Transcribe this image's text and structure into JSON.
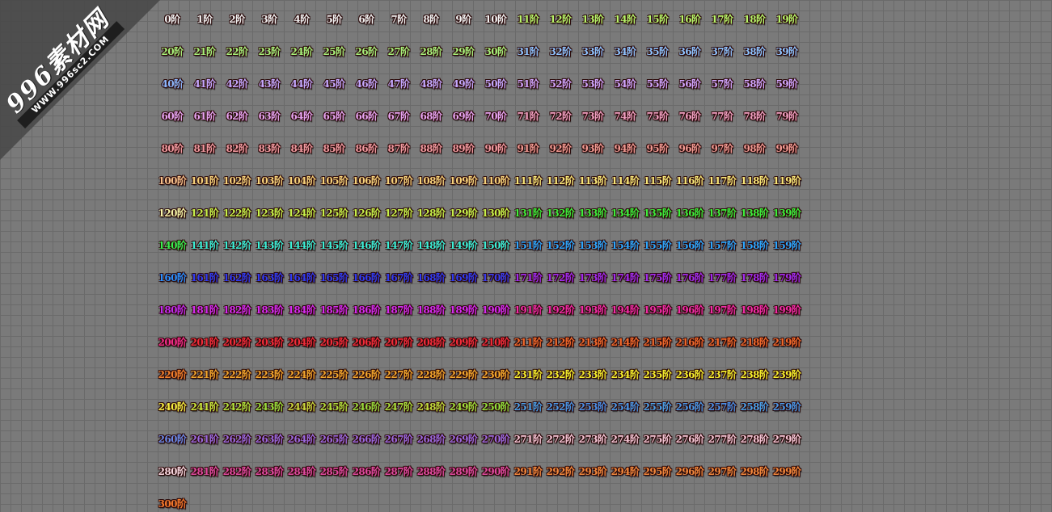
{
  "watermark": {
    "main": "996素材网",
    "sub": "WWW.996sc2.COM"
  },
  "level_suffix": "阶",
  "levels": [
    {
      "n": 0,
      "color": "#f4f4f4"
    },
    {
      "n": 1,
      "color": "#f2f2f2"
    },
    {
      "n": 2,
      "color": "#f2f2f2"
    },
    {
      "n": 3,
      "color": "#f2f2f2"
    },
    {
      "n": 4,
      "color": "#f2f2f2"
    },
    {
      "n": 5,
      "color": "#f2f2f2"
    },
    {
      "n": 6,
      "color": "#f2f2f2"
    },
    {
      "n": 7,
      "color": "#f2f2f2"
    },
    {
      "n": 8,
      "color": "#f2f2f2"
    },
    {
      "n": 9,
      "color": "#f2f2f2"
    },
    {
      "n": 10,
      "color": "#f2f2f2"
    },
    {
      "n": 11,
      "color": "#b6f56a"
    },
    {
      "n": 12,
      "color": "#b6f56a"
    },
    {
      "n": 13,
      "color": "#b6f56a"
    },
    {
      "n": 14,
      "color": "#b6f56a"
    },
    {
      "n": 15,
      "color": "#b6f56a"
    },
    {
      "n": 16,
      "color": "#b6f56a"
    },
    {
      "n": 17,
      "color": "#b6f56a"
    },
    {
      "n": 18,
      "color": "#b6f56a"
    },
    {
      "n": 19,
      "color": "#b6f56a"
    },
    {
      "n": 20,
      "color": "#a6f07a"
    },
    {
      "n": 21,
      "color": "#a6f07a"
    },
    {
      "n": 22,
      "color": "#a6f07a"
    },
    {
      "n": 23,
      "color": "#a6f07a"
    },
    {
      "n": 24,
      "color": "#a6f07a"
    },
    {
      "n": 25,
      "color": "#a6f07a"
    },
    {
      "n": 26,
      "color": "#a6f07a"
    },
    {
      "n": 27,
      "color": "#a6f07a"
    },
    {
      "n": 28,
      "color": "#a6f07a"
    },
    {
      "n": 29,
      "color": "#a6f07a"
    },
    {
      "n": 30,
      "color": "#a6f07a"
    },
    {
      "n": 31,
      "color": "#8ec4ff"
    },
    {
      "n": 32,
      "color": "#8ec4ff"
    },
    {
      "n": 33,
      "color": "#8ec4ff"
    },
    {
      "n": 34,
      "color": "#8ec4ff"
    },
    {
      "n": 35,
      "color": "#8ec4ff"
    },
    {
      "n": 36,
      "color": "#8ec4ff"
    },
    {
      "n": 37,
      "color": "#8ec4ff"
    },
    {
      "n": 38,
      "color": "#8ec4ff"
    },
    {
      "n": 39,
      "color": "#8ec4ff"
    },
    {
      "n": 40,
      "color": "#8cb8ff"
    },
    {
      "n": 41,
      "color": "#c4a8ff"
    },
    {
      "n": 42,
      "color": "#c4a8ff"
    },
    {
      "n": 43,
      "color": "#c4a8ff"
    },
    {
      "n": 44,
      "color": "#c4a8ff"
    },
    {
      "n": 45,
      "color": "#c4a8ff"
    },
    {
      "n": 46,
      "color": "#c4a8ff"
    },
    {
      "n": 47,
      "color": "#c4a8ff"
    },
    {
      "n": 48,
      "color": "#c4a8ff"
    },
    {
      "n": 49,
      "color": "#c4a8ff"
    },
    {
      "n": 50,
      "color": "#c4a8ff"
    },
    {
      "n": 51,
      "color": "#d0a6ff"
    },
    {
      "n": 52,
      "color": "#d0a6ff"
    },
    {
      "n": 53,
      "color": "#d0a6ff"
    },
    {
      "n": 54,
      "color": "#d0a6ff"
    },
    {
      "n": 55,
      "color": "#d0a6ff"
    },
    {
      "n": 56,
      "color": "#d0a6ff"
    },
    {
      "n": 57,
      "color": "#d0a6ff"
    },
    {
      "n": 58,
      "color": "#d0a6ff"
    },
    {
      "n": 59,
      "color": "#d0a6ff"
    },
    {
      "n": 60,
      "color": "#e6a4f2"
    },
    {
      "n": 61,
      "color": "#e6a4f2"
    },
    {
      "n": 62,
      "color": "#e6a4f2"
    },
    {
      "n": 63,
      "color": "#e6a4f2"
    },
    {
      "n": 64,
      "color": "#e6a4f2"
    },
    {
      "n": 65,
      "color": "#e6a4f2"
    },
    {
      "n": 66,
      "color": "#e6a4f2"
    },
    {
      "n": 67,
      "color": "#e6a4f2"
    },
    {
      "n": 68,
      "color": "#e6a4f2"
    },
    {
      "n": 69,
      "color": "#e6a4f2"
    },
    {
      "n": 70,
      "color": "#e6a4f2"
    },
    {
      "n": 71,
      "color": "#f2a0c2"
    },
    {
      "n": 72,
      "color": "#f2a0c2"
    },
    {
      "n": 73,
      "color": "#f2a0c2"
    },
    {
      "n": 74,
      "color": "#f2a0c2"
    },
    {
      "n": 75,
      "color": "#f2a0c2"
    },
    {
      "n": 76,
      "color": "#f2a0c2"
    },
    {
      "n": 77,
      "color": "#f2a0c2"
    },
    {
      "n": 78,
      "color": "#f2a0c2"
    },
    {
      "n": 79,
      "color": "#f2a0c2"
    },
    {
      "n": 80,
      "color": "#f29aa0"
    },
    {
      "n": 81,
      "color": "#f29aa0"
    },
    {
      "n": 82,
      "color": "#f29aa0"
    },
    {
      "n": 83,
      "color": "#f29aa0"
    },
    {
      "n": 84,
      "color": "#f29aa0"
    },
    {
      "n": 85,
      "color": "#f29aa0"
    },
    {
      "n": 86,
      "color": "#f29aa0"
    },
    {
      "n": 87,
      "color": "#f29aa0"
    },
    {
      "n": 88,
      "color": "#f29aa0"
    },
    {
      "n": 89,
      "color": "#f29aa0"
    },
    {
      "n": 90,
      "color": "#f29aa0"
    },
    {
      "n": 91,
      "color": "#f29a92"
    },
    {
      "n": 92,
      "color": "#f29a92"
    },
    {
      "n": 93,
      "color": "#f29a92"
    },
    {
      "n": 94,
      "color": "#f29a92"
    },
    {
      "n": 95,
      "color": "#f29a92"
    },
    {
      "n": 96,
      "color": "#f29a92"
    },
    {
      "n": 97,
      "color": "#f29a92"
    },
    {
      "n": 98,
      "color": "#f29a92"
    },
    {
      "n": 99,
      "color": "#f29a92"
    },
    {
      "n": 100,
      "color": "#f6c08a"
    },
    {
      "n": 101,
      "color": "#f6d27a"
    },
    {
      "n": 102,
      "color": "#f6d27a"
    },
    {
      "n": 103,
      "color": "#f6d27a"
    },
    {
      "n": 104,
      "color": "#f6d27a"
    },
    {
      "n": 105,
      "color": "#f6d27a"
    },
    {
      "n": 106,
      "color": "#f6d27a"
    },
    {
      "n": 107,
      "color": "#f6d27a"
    },
    {
      "n": 108,
      "color": "#f6d27a"
    },
    {
      "n": 109,
      "color": "#f6d27a"
    },
    {
      "n": 110,
      "color": "#f6d27a"
    },
    {
      "n": 111,
      "color": "#f8e878"
    },
    {
      "n": 112,
      "color": "#f8e878"
    },
    {
      "n": 113,
      "color": "#f8e878"
    },
    {
      "n": 114,
      "color": "#f8e878"
    },
    {
      "n": 115,
      "color": "#f8e878"
    },
    {
      "n": 116,
      "color": "#f8e878"
    },
    {
      "n": 117,
      "color": "#f8e878"
    },
    {
      "n": 118,
      "color": "#f8e878"
    },
    {
      "n": 119,
      "color": "#f8e878"
    },
    {
      "n": 120,
      "color": "#f6f6a8"
    },
    {
      "n": 121,
      "color": "#c6f24a"
    },
    {
      "n": 122,
      "color": "#c6f24a"
    },
    {
      "n": 123,
      "color": "#c6f24a"
    },
    {
      "n": 124,
      "color": "#c6f24a"
    },
    {
      "n": 125,
      "color": "#c6f24a"
    },
    {
      "n": 126,
      "color": "#c6f24a"
    },
    {
      "n": 127,
      "color": "#c6f24a"
    },
    {
      "n": 128,
      "color": "#c6f24a"
    },
    {
      "n": 129,
      "color": "#c6f24a"
    },
    {
      "n": 130,
      "color": "#c6f24a"
    },
    {
      "n": 131,
      "color": "#3cf03c"
    },
    {
      "n": 132,
      "color": "#3cf03c"
    },
    {
      "n": 133,
      "color": "#3cf03c"
    },
    {
      "n": 134,
      "color": "#3cf03c"
    },
    {
      "n": 135,
      "color": "#3cf03c"
    },
    {
      "n": 136,
      "color": "#3cf03c"
    },
    {
      "n": 137,
      "color": "#3cf03c"
    },
    {
      "n": 138,
      "color": "#3cf03c"
    },
    {
      "n": 139,
      "color": "#3cf03c"
    },
    {
      "n": 140,
      "color": "#38f050"
    },
    {
      "n": 141,
      "color": "#3cf0d8"
    },
    {
      "n": 142,
      "color": "#3cf0d8"
    },
    {
      "n": 143,
      "color": "#3cf0d8"
    },
    {
      "n": 144,
      "color": "#3cf0d8"
    },
    {
      "n": 145,
      "color": "#3cf0d8"
    },
    {
      "n": 146,
      "color": "#3cf0d8"
    },
    {
      "n": 147,
      "color": "#3cf0d8"
    },
    {
      "n": 148,
      "color": "#3cf0d8"
    },
    {
      "n": 149,
      "color": "#3cf0d8"
    },
    {
      "n": 150,
      "color": "#3cf0d8"
    },
    {
      "n": 151,
      "color": "#2ca8ff"
    },
    {
      "n": 152,
      "color": "#2ca8ff"
    },
    {
      "n": 153,
      "color": "#2ca8ff"
    },
    {
      "n": 154,
      "color": "#2ca8ff"
    },
    {
      "n": 155,
      "color": "#2ca8ff"
    },
    {
      "n": 156,
      "color": "#2ca8ff"
    },
    {
      "n": 157,
      "color": "#2ca8ff"
    },
    {
      "n": 158,
      "color": "#2ca8ff"
    },
    {
      "n": 159,
      "color": "#2ca8ff"
    },
    {
      "n": 160,
      "color": "#2a90ff"
    },
    {
      "n": 161,
      "color": "#2f3cf2"
    },
    {
      "n": 162,
      "color": "#2f3cf2"
    },
    {
      "n": 163,
      "color": "#2f3cf2"
    },
    {
      "n": 164,
      "color": "#2f3cf2"
    },
    {
      "n": 165,
      "color": "#2f3cf2"
    },
    {
      "n": 166,
      "color": "#2f3cf2"
    },
    {
      "n": 167,
      "color": "#2f3cf2"
    },
    {
      "n": 168,
      "color": "#2f3cf2"
    },
    {
      "n": 169,
      "color": "#2f3cf2"
    },
    {
      "n": 170,
      "color": "#3a3ef0"
    },
    {
      "n": 171,
      "color": "#a02cf0"
    },
    {
      "n": 172,
      "color": "#a02cf0"
    },
    {
      "n": 173,
      "color": "#a02cf0"
    },
    {
      "n": 174,
      "color": "#a02cf0"
    },
    {
      "n": 175,
      "color": "#a02cf0"
    },
    {
      "n": 176,
      "color": "#a02cf0"
    },
    {
      "n": 177,
      "color": "#a02cf0"
    },
    {
      "n": 178,
      "color": "#a02cf0"
    },
    {
      "n": 179,
      "color": "#a02cf0"
    },
    {
      "n": 180,
      "color": "#c02cf0"
    },
    {
      "n": 181,
      "color": "#d42cf2"
    },
    {
      "n": 182,
      "color": "#d42cf2"
    },
    {
      "n": 183,
      "color": "#d42cf2"
    },
    {
      "n": 184,
      "color": "#d42cf2"
    },
    {
      "n": 185,
      "color": "#d42cf2"
    },
    {
      "n": 186,
      "color": "#d42cf2"
    },
    {
      "n": 187,
      "color": "#d42cf2"
    },
    {
      "n": 188,
      "color": "#d42cf2"
    },
    {
      "n": 189,
      "color": "#d42cf2"
    },
    {
      "n": 190,
      "color": "#d42cf2"
    },
    {
      "n": 191,
      "color": "#f22ca8"
    },
    {
      "n": 192,
      "color": "#f22ca8"
    },
    {
      "n": 193,
      "color": "#f22ca8"
    },
    {
      "n": 194,
      "color": "#f22ca8"
    },
    {
      "n": 195,
      "color": "#f22ca8"
    },
    {
      "n": 196,
      "color": "#f22ca8"
    },
    {
      "n": 197,
      "color": "#f22ca8"
    },
    {
      "n": 198,
      "color": "#f22ca8"
    },
    {
      "n": 199,
      "color": "#f22ca8"
    },
    {
      "n": 200,
      "color": "#f22c8a"
    },
    {
      "n": 201,
      "color": "#f22c3a"
    },
    {
      "n": 202,
      "color": "#f22c3a"
    },
    {
      "n": 203,
      "color": "#f22c3a"
    },
    {
      "n": 204,
      "color": "#f22c3a"
    },
    {
      "n": 205,
      "color": "#f22c3a"
    },
    {
      "n": 206,
      "color": "#f22c3a"
    },
    {
      "n": 207,
      "color": "#f22c3a"
    },
    {
      "n": 208,
      "color": "#f22c3a"
    },
    {
      "n": 209,
      "color": "#f22c3a"
    },
    {
      "n": 210,
      "color": "#f22c3a"
    },
    {
      "n": 211,
      "color": "#f26a2c"
    },
    {
      "n": 212,
      "color": "#f26a2c"
    },
    {
      "n": 213,
      "color": "#f26a2c"
    },
    {
      "n": 214,
      "color": "#f26a2c"
    },
    {
      "n": 215,
      "color": "#f26a2c"
    },
    {
      "n": 216,
      "color": "#f26a2c"
    },
    {
      "n": 217,
      "color": "#f26a2c"
    },
    {
      "n": 218,
      "color": "#f26a2c"
    },
    {
      "n": 219,
      "color": "#f26a2c"
    },
    {
      "n": 220,
      "color": "#f2802c"
    },
    {
      "n": 221,
      "color": "#f2a62c"
    },
    {
      "n": 222,
      "color": "#f2a62c"
    },
    {
      "n": 223,
      "color": "#f2a62c"
    },
    {
      "n": 224,
      "color": "#f2a62c"
    },
    {
      "n": 225,
      "color": "#f2a62c"
    },
    {
      "n": 226,
      "color": "#f2a62c"
    },
    {
      "n": 227,
      "color": "#f2a62c"
    },
    {
      "n": 228,
      "color": "#f2a62c"
    },
    {
      "n": 229,
      "color": "#f2a62c"
    },
    {
      "n": 230,
      "color": "#f2a62c"
    },
    {
      "n": 231,
      "color": "#f6f02c"
    },
    {
      "n": 232,
      "color": "#f6f02c"
    },
    {
      "n": 233,
      "color": "#f6f02c"
    },
    {
      "n": 234,
      "color": "#f6f02c"
    },
    {
      "n": 235,
      "color": "#f6f02c"
    },
    {
      "n": 236,
      "color": "#f6f02c"
    },
    {
      "n": 237,
      "color": "#f6f02c"
    },
    {
      "n": 238,
      "color": "#f6f02c"
    },
    {
      "n": 239,
      "color": "#f6f02c"
    },
    {
      "n": 240,
      "color": "#f6f040"
    },
    {
      "n": 241,
      "color": "#c8e83c"
    },
    {
      "n": 242,
      "color": "#b0e43c"
    },
    {
      "n": 243,
      "color": "#98e03c"
    },
    {
      "n": 244,
      "color": "#c8d83c"
    },
    {
      "n": 245,
      "color": "#b0e03c"
    },
    {
      "n": 246,
      "color": "#98dc3c"
    },
    {
      "n": 247,
      "color": "#a8e03c"
    },
    {
      "n": 248,
      "color": "#c0dc3c"
    },
    {
      "n": 249,
      "color": "#a0e03c"
    },
    {
      "n": 250,
      "color": "#90e03c"
    },
    {
      "n": 251,
      "color": "#4aa0e8"
    },
    {
      "n": 252,
      "color": "#4a98e8"
    },
    {
      "n": 253,
      "color": "#4a90e8"
    },
    {
      "n": 254,
      "color": "#4a98e8"
    },
    {
      "n": 255,
      "color": "#4aa0e8"
    },
    {
      "n": 256,
      "color": "#4a98e8"
    },
    {
      "n": 257,
      "color": "#4a90e8"
    },
    {
      "n": 258,
      "color": "#4aa0e8"
    },
    {
      "n": 259,
      "color": "#4a98e8"
    },
    {
      "n": 260,
      "color": "#6a8ae8"
    },
    {
      "n": 261,
      "color": "#9a6ae0"
    },
    {
      "n": 262,
      "color": "#9a6ae0"
    },
    {
      "n": 263,
      "color": "#9a6ae0"
    },
    {
      "n": 264,
      "color": "#9a6ae0"
    },
    {
      "n": 265,
      "color": "#9a6ae0"
    },
    {
      "n": 266,
      "color": "#9a6ae0"
    },
    {
      "n": 267,
      "color": "#9a6ae0"
    },
    {
      "n": 268,
      "color": "#9a6ae0"
    },
    {
      "n": 269,
      "color": "#9a6ae0"
    },
    {
      "n": 270,
      "color": "#9a6ae0"
    },
    {
      "n": 271,
      "color": "#f6c6d6"
    },
    {
      "n": 272,
      "color": "#f6c6d6"
    },
    {
      "n": 273,
      "color": "#f6c6d6"
    },
    {
      "n": 274,
      "color": "#f6c6d6"
    },
    {
      "n": 275,
      "color": "#f6c6d6"
    },
    {
      "n": 276,
      "color": "#f6c6d6"
    },
    {
      "n": 277,
      "color": "#f6c6d6"
    },
    {
      "n": 278,
      "color": "#f6c6d6"
    },
    {
      "n": 279,
      "color": "#f6c6d6"
    },
    {
      "n": 280,
      "color": "#f8d8e0"
    },
    {
      "n": 281,
      "color": "#e04aa0"
    },
    {
      "n": 282,
      "color": "#e04aa0"
    },
    {
      "n": 283,
      "color": "#e04aa0"
    },
    {
      "n": 284,
      "color": "#e04aa0"
    },
    {
      "n": 285,
      "color": "#e04aa0"
    },
    {
      "n": 286,
      "color": "#e04aa0"
    },
    {
      "n": 287,
      "color": "#e04aa0"
    },
    {
      "n": 288,
      "color": "#e04aa0"
    },
    {
      "n": 289,
      "color": "#e04aa0"
    },
    {
      "n": 290,
      "color": "#e04aa0"
    },
    {
      "n": 291,
      "color": "#f2883c"
    },
    {
      "n": 292,
      "color": "#f2883c"
    },
    {
      "n": 293,
      "color": "#f2883c"
    },
    {
      "n": 294,
      "color": "#f2883c"
    },
    {
      "n": 295,
      "color": "#f2883c"
    },
    {
      "n": 296,
      "color": "#f2883c"
    },
    {
      "n": 297,
      "color": "#f2883c"
    },
    {
      "n": 298,
      "color": "#f2883c"
    },
    {
      "n": 299,
      "color": "#f2883c"
    },
    {
      "n": 300,
      "color": "#f2782c"
    }
  ]
}
